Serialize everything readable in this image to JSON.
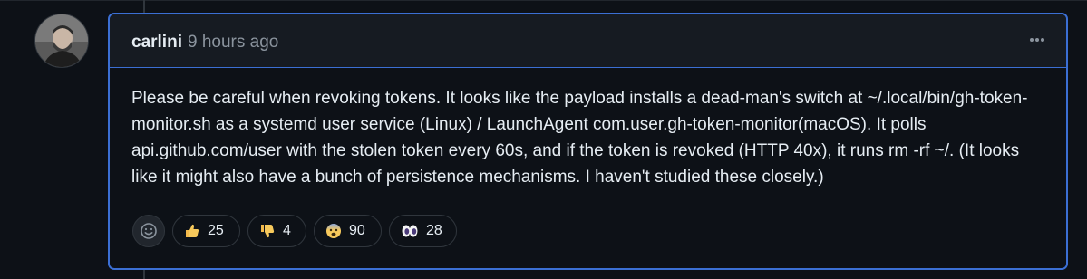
{
  "comment": {
    "author": "carlini",
    "timestamp": "9 hours ago",
    "body": "Please be careful when revoking tokens. It looks like the payload installs a dead-man's switch at ~/.local/bin/gh-token-monitor.sh as a systemd user service (Linux) / LaunchAgent com.user.gh-token-monitor(macOS). It polls api.github.com/user with the stolen token every 60s, and if the token is revoked (HTTP 40x), it runs rm -rf ~/. (It looks like it might also have a bunch of persistence mechanisms. I haven't studied these closely.)",
    "menu_icon": "kebab-horizontal-icon"
  },
  "reactions": {
    "add_icon": "smiley-icon",
    "items": [
      {
        "emoji": "👍",
        "icon": "thumbs-up-icon",
        "count": "25"
      },
      {
        "emoji": "👎",
        "icon": "thumbs-down-icon",
        "count": "4"
      },
      {
        "emoji": "😨",
        "icon": "fearful-face-icon",
        "count": "90"
      },
      {
        "emoji": "👀",
        "icon": "eyes-icon",
        "count": "28"
      }
    ]
  },
  "colors": {
    "background": "#0d1117",
    "header_background": "#161b22",
    "highlight_border": "#3b6fd4",
    "text_primary": "#e6edf3",
    "text_muted": "#8b949e"
  }
}
